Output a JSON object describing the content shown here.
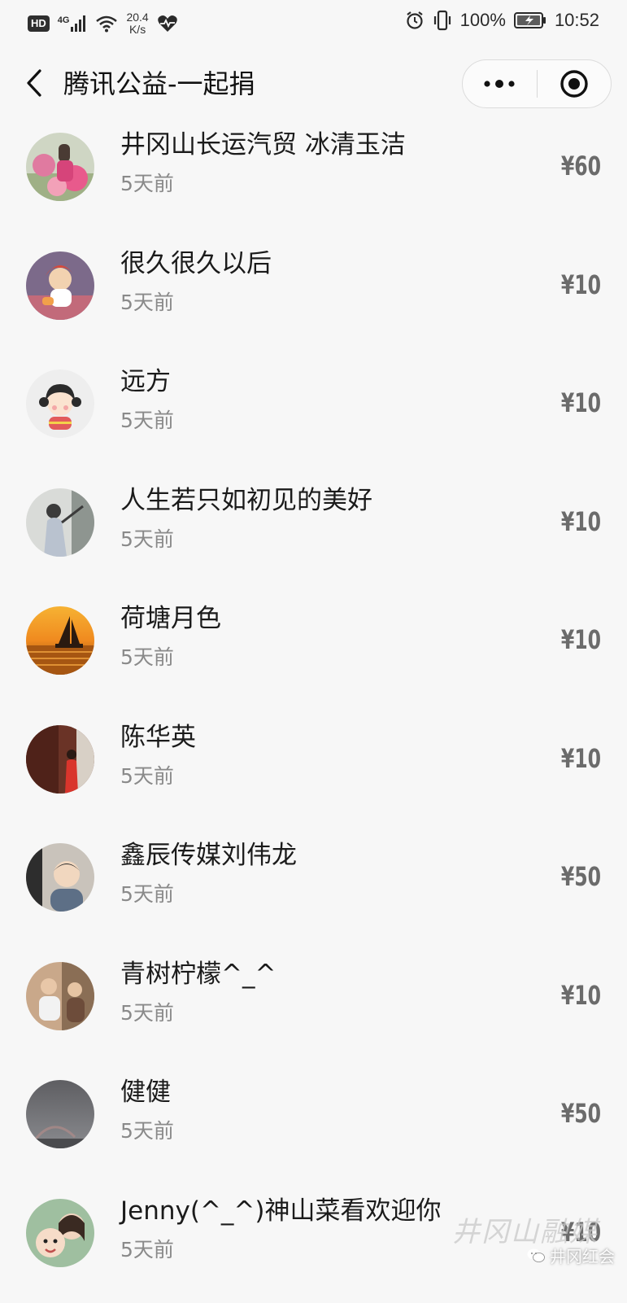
{
  "status_bar": {
    "hd_label": "HD",
    "signal_label": "4G",
    "net_speed_value": "20.4",
    "net_speed_unit": "K/s",
    "battery_percent": "100%",
    "time": "10:52"
  },
  "nav": {
    "title": "腾讯公益-一起捐"
  },
  "donors": [
    {
      "name": "井冈山长运汽贸 冰清玉洁",
      "time": "5天前",
      "amount": "¥60"
    },
    {
      "name": "很久很久以后",
      "time": "5天前",
      "amount": "¥10"
    },
    {
      "name": "远方",
      "time": "5天前",
      "amount": "¥10"
    },
    {
      "name": "人生若只如初见的美好",
      "time": "5天前",
      "amount": "¥10"
    },
    {
      "name": "荷塘月色",
      "time": "5天前",
      "amount": "¥10"
    },
    {
      "name": "陈华英",
      "time": "5天前",
      "amount": "¥10"
    },
    {
      "name": "鑫辰传媒刘伟龙",
      "time": "5天前",
      "amount": "¥50"
    },
    {
      "name": "青树柠檬^_^",
      "time": "5天前",
      "amount": "¥10"
    },
    {
      "name": "健健",
      "time": "5天前",
      "amount": "¥50"
    },
    {
      "name": "Jenny(^_^)神山菜看欢迎你",
      "time": "5天前",
      "amount": "¥10"
    }
  ],
  "watermark": {
    "script_text": "井冈山融媒",
    "account_name": "井冈红会"
  },
  "colors": {
    "background": "#f7f7f7",
    "name_text": "#1b1b1b",
    "time_text": "#8a8a8a",
    "amount_text": "#6b6b6b"
  }
}
